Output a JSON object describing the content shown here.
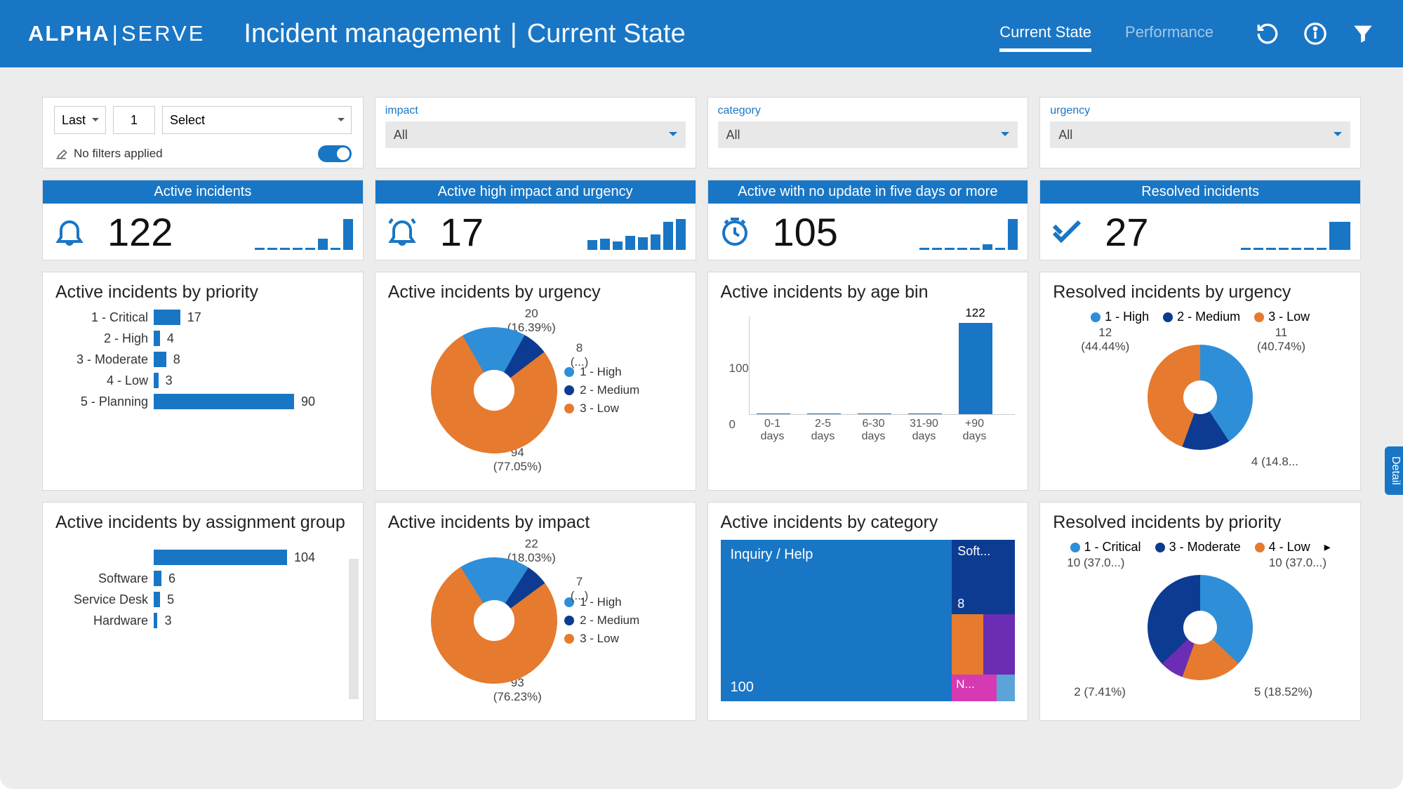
{
  "brand": {
    "left": "ALPHA",
    "right": "SERVE"
  },
  "page": {
    "title": "Incident management",
    "subtitle": "Current State"
  },
  "nav": {
    "a": "Current State",
    "b": "Performance"
  },
  "filters": {
    "time_last": "Last",
    "time_n": "1",
    "time_unit": "Select",
    "no_filters": "No filters applied",
    "impact": {
      "label": "impact",
      "value": "All"
    },
    "category": {
      "label": "category",
      "value": "All"
    },
    "urgency": {
      "label": "urgency",
      "value": "All"
    }
  },
  "kpi": {
    "active": {
      "title": "Active incidents",
      "value": "122"
    },
    "highimp": {
      "title": "Active high impact and urgency",
      "value": "17"
    },
    "noupd": {
      "title": "Active with no update in five days or more",
      "value": "105"
    },
    "resolved": {
      "title": "Resolved incidents",
      "value": "27"
    }
  },
  "charts": {
    "priority": {
      "title": "Active incidents by priority"
    },
    "urgency": {
      "title": "Active incidents by urgency"
    },
    "agebin": {
      "title": "Active incidents by age bin"
    },
    "resurg": {
      "title": "Resolved incidents by urgency"
    },
    "assign": {
      "title": "Active incidents by assignment group"
    },
    "impact": {
      "title": "Active incidents by impact"
    },
    "category": {
      "title": "Active incidents by category"
    },
    "resprio": {
      "title": "Resolved incidents by priority"
    }
  },
  "detail_tab": "Detail",
  "chart_data": [
    {
      "id": "priority",
      "type": "bar",
      "orientation": "horizontal",
      "categories": [
        "1 - Critical",
        "2 - High",
        "3 - Moderate",
        "4 - Low",
        "5 - Planning"
      ],
      "values": [
        17,
        4,
        8,
        3,
        90
      ]
    },
    {
      "id": "urgency",
      "type": "pie",
      "series": [
        {
          "name": "1 - High",
          "value": 20,
          "pct": 16.39,
          "color": "#2f8ed8"
        },
        {
          "name": "2 - Medium",
          "value": 8,
          "pct": 6.56,
          "label2": "(...)",
          "color": "#0d3b91"
        },
        {
          "name": "3 - Low",
          "value": 94,
          "pct": 77.05,
          "color": "#e67a2e"
        }
      ]
    },
    {
      "id": "agebin",
      "type": "bar",
      "categories": [
        "0-1 days",
        "2-5 days",
        "6-30 days",
        "31-90 days",
        "+90 days"
      ],
      "values": [
        0,
        0,
        0,
        0,
        122
      ],
      "ylim": [
        0,
        100
      ],
      "yticks": [
        0,
        100
      ]
    },
    {
      "id": "resurg",
      "type": "pie",
      "series": [
        {
          "name": "1 - High",
          "value": 11,
          "pct": 40.74,
          "color": "#2f8ed8"
        },
        {
          "name": "2 - Medium",
          "value": 4,
          "pct": 14.8,
          "label2": "4 (14.8...",
          "color": "#0d3b91"
        },
        {
          "name": "3 - Low",
          "value": 12,
          "pct": 44.44,
          "color": "#e67a2e"
        }
      ]
    },
    {
      "id": "assign",
      "type": "bar",
      "orientation": "horizontal",
      "categories": [
        "",
        "Software",
        "Service Desk",
        "Hardware"
      ],
      "values": [
        104,
        6,
        5,
        3
      ]
    },
    {
      "id": "impact",
      "type": "pie",
      "series": [
        {
          "name": "1 - High",
          "value": 22,
          "pct": 18.03,
          "color": "#2f8ed8"
        },
        {
          "name": "2 - Medium",
          "value": 7,
          "pct": 5.74,
          "label2": "(...)",
          "color": "#0d3b91"
        },
        {
          "name": "3 - Low",
          "value": 93,
          "pct": 76.23,
          "color": "#e67a2e"
        }
      ]
    },
    {
      "id": "category",
      "type": "treemap",
      "items": [
        {
          "name": "Inquiry / Help",
          "value": 100,
          "color": "#1976c5"
        },
        {
          "name": "Soft...",
          "value": 8,
          "color": "#0d3b91"
        },
        {
          "name": "",
          "value": 5,
          "color": "#e67a2e"
        },
        {
          "name": "",
          "value": 5,
          "color": "#6b2db3"
        },
        {
          "name": "N...",
          "value": 3,
          "color": "#d63ab3"
        },
        {
          "name": "",
          "value": 1,
          "color": "#5aa4d8"
        }
      ]
    },
    {
      "id": "resprio",
      "type": "pie",
      "series": [
        {
          "name": "1 - Critical",
          "value": 10,
          "pct": 37.0,
          "label2": "10 (37.0...)",
          "color": "#2f8ed8"
        },
        {
          "name": "3 - Moderate",
          "value": 10,
          "pct": 37.0,
          "label2": "10 (37.0...)",
          "color": "#0d3b91"
        },
        {
          "name": "4 - Low",
          "value": 5,
          "pct": 18.52,
          "color": "#e67a2e"
        },
        {
          "name": "",
          "value": 2,
          "pct": 7.41,
          "label2": "2 (7.41%)",
          "color": "#6b2db3"
        }
      ]
    }
  ]
}
